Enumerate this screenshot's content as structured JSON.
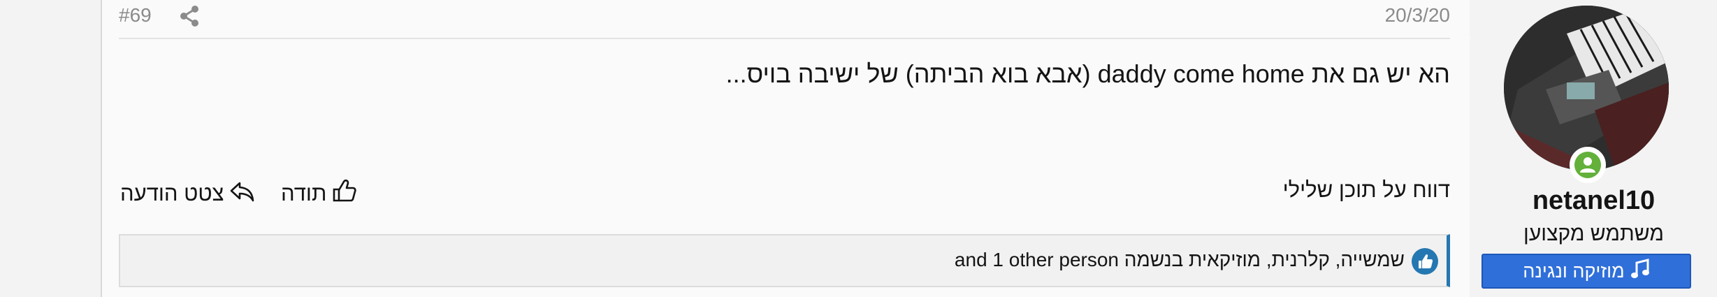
{
  "post": {
    "number": "#69",
    "date": "20/3/20",
    "content": "הא יש גם את daddy come home (אבא בוא הביתה) של ישיבה בויס...",
    "report_label": "דווח על תוכן שלילי",
    "like_label": "תודה",
    "quote_label": "צטט הודעה",
    "reactions_text": "שמשייה, קלרנית, מוזיקאית בנשמה and 1 other person"
  },
  "author": {
    "username": "netanel10",
    "title": "משתמש מקצוען",
    "banner": "מוזיקה ונגינה"
  },
  "colors": {
    "accent": "#2577b1",
    "banner": "#2f6fd9",
    "online": "#63b03a"
  },
  "icons": [
    "share-icon",
    "thumbs-up-icon",
    "reply-icon",
    "like-badge-icon",
    "user-online-icon",
    "music-note-icon"
  ]
}
